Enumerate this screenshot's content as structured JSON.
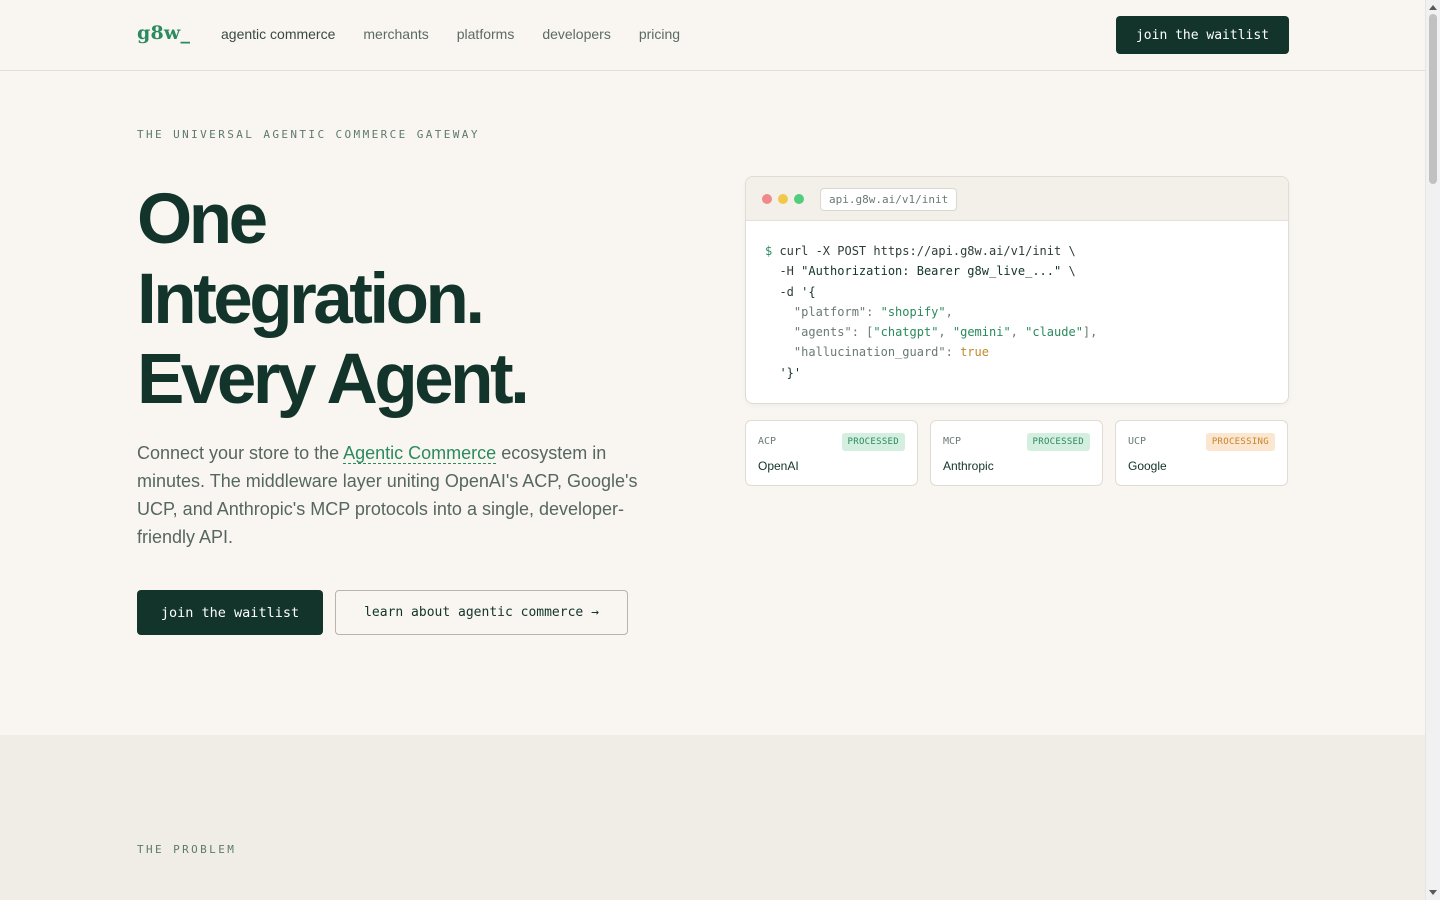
{
  "header": {
    "logo": "g8w_",
    "nav": [
      {
        "label": "agentic commerce"
      },
      {
        "label": "merchants"
      },
      {
        "label": "platforms"
      },
      {
        "label": "developers"
      },
      {
        "label": "pricing"
      }
    ],
    "cta_label": "join the waitlist"
  },
  "hero": {
    "eyebrow": "THE UNIVERSAL AGENTIC COMMERCE GATEWAY",
    "title_lines": [
      "One",
      "Integration.",
      "Every Agent."
    ],
    "desc_pre": "Connect your store to the ",
    "desc_link": "Agentic Commerce",
    "desc_post": " ecosystem in minutes. The middleware layer uniting OpenAI's ACP, Google's UCP, and Anthropic's MCP protocols into a single, developer-friendly API.",
    "primary_label": "join the waitlist",
    "secondary_label": "learn about agentic commerce →"
  },
  "terminal": {
    "url": "api.g8w.ai/v1/init",
    "prompt": "$",
    "line1": " curl -X POST https://api.g8w.ai/v1/init \\",
    "line2_pre": "  -H ",
    "line2_str": "\"Authorization: Bearer g8w_live_...\"",
    "line2_post": " \\",
    "line3_pre": "  -d ",
    "line3_str": "'{",
    "platform_key": "\"platform\"",
    "platform_val": "\"shopify\"",
    "agents_key": "\"agents\"",
    "agents_vals": [
      "\"chatgpt\"",
      "\"gemini\"",
      "\"claude\""
    ],
    "guard_key": "\"hallucination_guard\"",
    "guard_val": "true",
    "closing": "'}'"
  },
  "protocols": [
    {
      "code": "ACP",
      "status": "PROCESSED",
      "name": "OpenAI",
      "state": "processed"
    },
    {
      "code": "MCP",
      "status": "PROCESSED",
      "name": "Anthropic",
      "state": "processed"
    },
    {
      "code": "UCP",
      "status": "PROCESSING",
      "name": "Google",
      "state": "processing"
    }
  ],
  "problem": {
    "eyebrow": "THE PROBLEM"
  }
}
